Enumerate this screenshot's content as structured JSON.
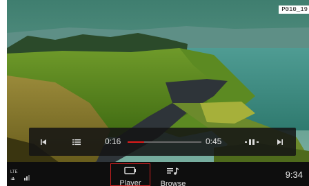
{
  "corner_label": "P010_19",
  "player": {
    "elapsed": "0:16",
    "duration": "0:45",
    "progress": 0.22,
    "accent_color": "#e21b1b"
  },
  "icons": {
    "previous": "skip-previous-icon",
    "playlist": "playlist-icon",
    "pause": "pause-icon",
    "next": "skip-next-icon",
    "player_tab": "car-screen-icon",
    "browse_tab": "music-list-icon"
  },
  "statusbar": {
    "network": "LTE",
    "tabs": [
      {
        "label": "Player",
        "selected": true
      },
      {
        "label": "Browse",
        "selected": false
      }
    ],
    "clock": "9:34"
  }
}
